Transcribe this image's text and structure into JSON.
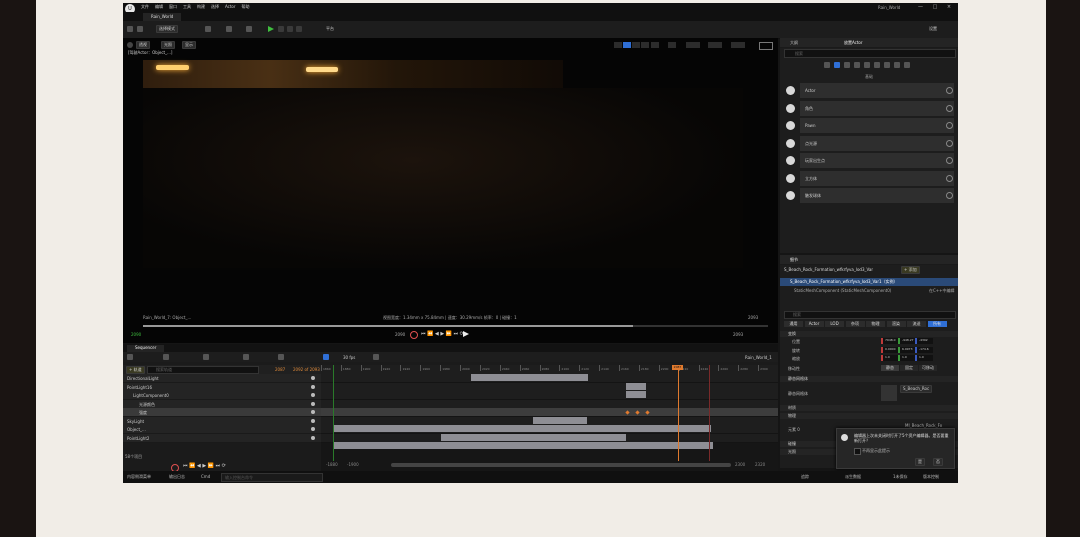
{
  "window": {
    "title": "Rain_World",
    "logo": "ue-logo-icon",
    "menu": [
      "文件",
      "编辑",
      "窗口",
      "工具",
      "构建",
      "选择",
      "Actor",
      "帮助"
    ],
    "tab": "Rain_World",
    "settings_label": "设置",
    "controls": [
      "—",
      "□",
      "×"
    ]
  },
  "toolbar": {
    "mode_label": "选择模式",
    "platform_label": "平台"
  },
  "viewport": {
    "buttons": [
      "透视",
      "光照",
      "显示"
    ],
    "pilot_label": "[驾驶Actor：Object_...]",
    "bottom_left": "Rain_World_7: Object_...",
    "status": "视图宽度：1.34mm x 75.84mm | 速度：30.29mm/s 帧率：0 | 碰撞：1",
    "frame_left": "2090",
    "frame_right": "2093",
    "time_left": "2090",
    "time_right": "2093"
  },
  "place_actors": {
    "tabs": [
      "大纲",
      "放置Actor"
    ],
    "search_placeholder": "搜索",
    "category": "基础",
    "items": [
      {
        "label": "Actor",
        "icon": "sphere-icon"
      },
      {
        "label": "角色",
        "icon": "character-icon"
      },
      {
        "label": "Pawn",
        "icon": "pawn-icon"
      },
      {
        "label": "点光源",
        "icon": "light-bulb-icon"
      },
      {
        "label": "玩家出生点",
        "icon": "player-start-icon"
      },
      {
        "label": "立方体",
        "icon": "cube-icon"
      },
      {
        "label": "触发球体",
        "icon": "sphere-trigger-icon"
      }
    ]
  },
  "details": {
    "tab": "细节",
    "actor_name": "S_Beach_Rock_Formation_wfkrfyva_lod3_Var",
    "add_label": "+ 添加",
    "selected_component": "S_Beach_Rock_Formation_wfkrfyva_lod3_Var1（实例）",
    "sub_component": "StaticMeshComponent (StaticMeshComponent0)",
    "edit_in_cpp": "在C++中编辑",
    "search_placeholder": "搜索",
    "filter_tabs": [
      "通用",
      "Actor",
      "LOD",
      "杂项",
      "物理",
      "渲染",
      "流送",
      "所有"
    ],
    "section_transform": "变换",
    "transform_rows": [
      {
        "label": "位置",
        "x": "7948.0",
        "y": "-948.27",
        "z": "-4392"
      },
      {
        "label": "旋转",
        "x": "0.0000",
        "y": "6.9973",
        "z": "-174.6"
      },
      {
        "label": "缩放",
        "x": "1.0",
        "y": "1.0",
        "z": "1.0"
      }
    ],
    "mobility_label": "移动性",
    "mobility_options": [
      "静态",
      "固定",
      "可移动"
    ],
    "section_static_mesh": "静态网格体",
    "static_mesh_label": "静态网格体",
    "static_mesh_value": "S_Beach_Roc",
    "section_materials": "材质",
    "section_physics": "物理",
    "section_collision": "碰撞",
    "element_label": "元素 0",
    "element_value": "MI_Beach_Rock_Fo",
    "section_lighting": "光照"
  },
  "notification": {
    "text": "编辑器上次未关闭时打开了5个资产编辑器。是否要重新打开？",
    "checkbox_label": "不再显示此提示",
    "buttons": [
      "是",
      "否"
    ]
  },
  "sequencer": {
    "tab": "Sequencer",
    "add_track": "+ 轨道",
    "search_placeholder": "搜索轨道",
    "fps_label": "30 fps",
    "sequence_name": "Rain_World_1",
    "current_frame": "2087",
    "start_frame": "2087",
    "end_frame": "2092 of 2093",
    "tracks": [
      {
        "label": "DirectionalLight",
        "indent": 0
      },
      {
        "label": "PointLight16",
        "indent": 0
      },
      {
        "label": "LightComponent0",
        "indent": 1
      },
      {
        "label": "光源颜色",
        "indent": 2
      },
      {
        "label": "强度",
        "indent": 2
      },
      {
        "label": "SkyLight",
        "indent": 0
      },
      {
        "label": "Object_...",
        "indent": 0
      },
      {
        "label": "PointLight2",
        "indent": 0
      }
    ],
    "items_count": "58个项目",
    "ruler": [
      "1860",
      "1880",
      "1900",
      "1920",
      "1940",
      "1960",
      "1980",
      "2000",
      "2020",
      "2040",
      "2060",
      "2080",
      "2100",
      "2120",
      "2140",
      "2160",
      "2180",
      "2200",
      "2220",
      "2240",
      "2260",
      "2280",
      "2300"
    ],
    "left_range": "-1880",
    "left_range2": "-1900",
    "right_range": "2300",
    "right_range2": "2320"
  },
  "statusbar": {
    "items": [
      "内容侧滑菜单",
      "输出日志",
      "Cmd"
    ],
    "input_placeholder": "输入控制台命令",
    "right_items": [
      "追踪",
      "派生数据",
      "1未保存",
      "版本控制"
    ]
  }
}
